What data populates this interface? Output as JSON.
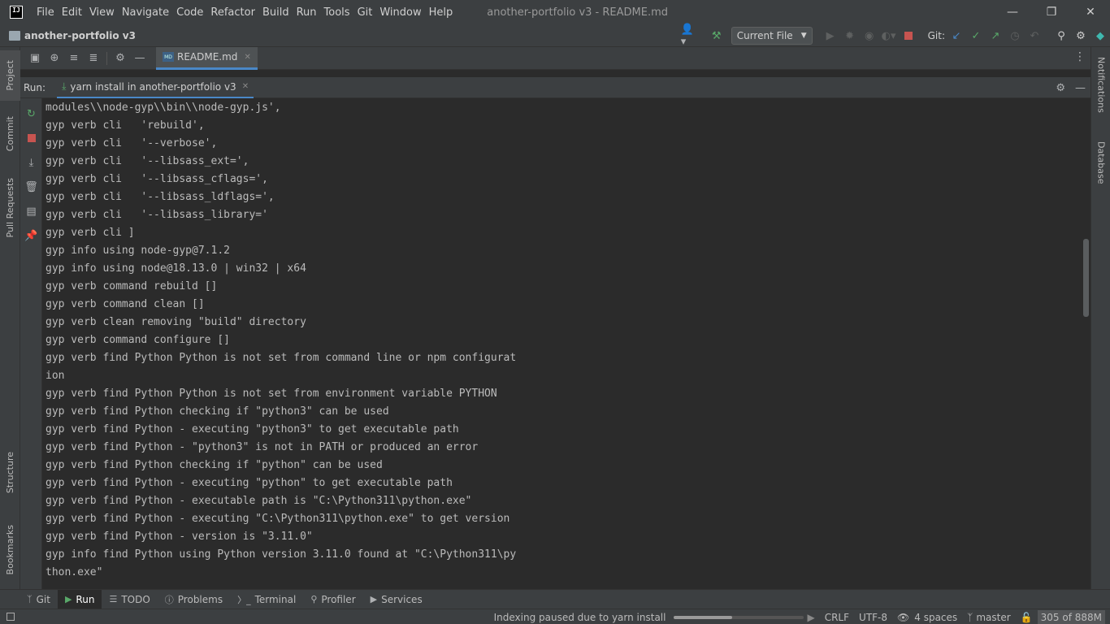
{
  "app": {
    "logo_text": "IJ",
    "menu": [
      "File",
      "Edit",
      "View",
      "Navigate",
      "Code",
      "Refactor",
      "Build",
      "Run",
      "Tools",
      "Git",
      "Window",
      "Help"
    ],
    "window_title": "another-portfolio v3 - README.md"
  },
  "navbar": {
    "project_name": "another-portfolio v3",
    "run_config": "Current File",
    "git_label": "Git:"
  },
  "left_tools": [
    "Project",
    "Commit",
    "Pull Requests",
    "Structure",
    "Bookmarks"
  ],
  "right_tools": [
    "Notifications",
    "Database"
  ],
  "editor": {
    "tab_icon_text": "MD",
    "tab_label": "README.md"
  },
  "run_panel": {
    "label": "Run:",
    "tab_label": "yarn install in another-portfolio v3"
  },
  "console": {
    "lines": [
      "modules\\\\node-gyp\\\\bin\\\\node-gyp.js',",
      "gyp verb cli   'rebuild',",
      "gyp verb cli   '--verbose',",
      "gyp verb cli   '--libsass_ext=',",
      "gyp verb cli   '--libsass_cflags=',",
      "gyp verb cli   '--libsass_ldflags=',",
      "gyp verb cli   '--libsass_library='",
      "gyp verb cli ]",
      "gyp info using node-gyp@7.1.2",
      "gyp info using node@18.13.0 | win32 | x64",
      "gyp verb command rebuild []",
      "gyp verb command clean []",
      "gyp verb clean removing \"build\" directory",
      "gyp verb command configure []",
      "gyp verb find Python Python is not set from command line or npm configurat",
      "ion",
      "gyp verb find Python Python is not set from environment variable PYTHON",
      "gyp verb find Python checking if \"python3\" can be used",
      "gyp verb find Python - executing \"python3\" to get executable path",
      "gyp verb find Python - \"python3\" is not in PATH or produced an error",
      "gyp verb find Python checking if \"python\" can be used",
      "gyp verb find Python - executing \"python\" to get executable path",
      "gyp verb find Python - executable path is \"C:\\Python311\\python.exe\"",
      "gyp verb find Python - executing \"C:\\Python311\\python.exe\" to get version",
      "gyp verb find Python - version is \"3.11.0\"",
      "gyp info find Python using Python version 3.11.0 found at \"C:\\Python311\\py",
      "thon.exe\""
    ]
  },
  "bottom_tabs": [
    {
      "label": "Git",
      "icon": "git-branch-icon"
    },
    {
      "label": "Run",
      "icon": "play-icon"
    },
    {
      "label": "TODO",
      "icon": "list-icon"
    },
    {
      "label": "Problems",
      "icon": "info-icon"
    },
    {
      "label": "Terminal",
      "icon": "terminal-icon"
    },
    {
      "label": "Profiler",
      "icon": "profiler-icon"
    },
    {
      "label": "Services",
      "icon": "services-icon"
    }
  ],
  "status": {
    "message": "Indexing paused due to yarn install",
    "progress": 0.45,
    "line_separator": "CRLF",
    "encoding": "UTF-8",
    "indent": "4 spaces",
    "branch": "master",
    "memory": "305 of 888M"
  },
  "colors": {
    "accent": "#4a88c7",
    "run_green": "#59a869",
    "stop_red": "#c75450",
    "background": "#2b2b2b",
    "panel": "#3c3f41"
  }
}
